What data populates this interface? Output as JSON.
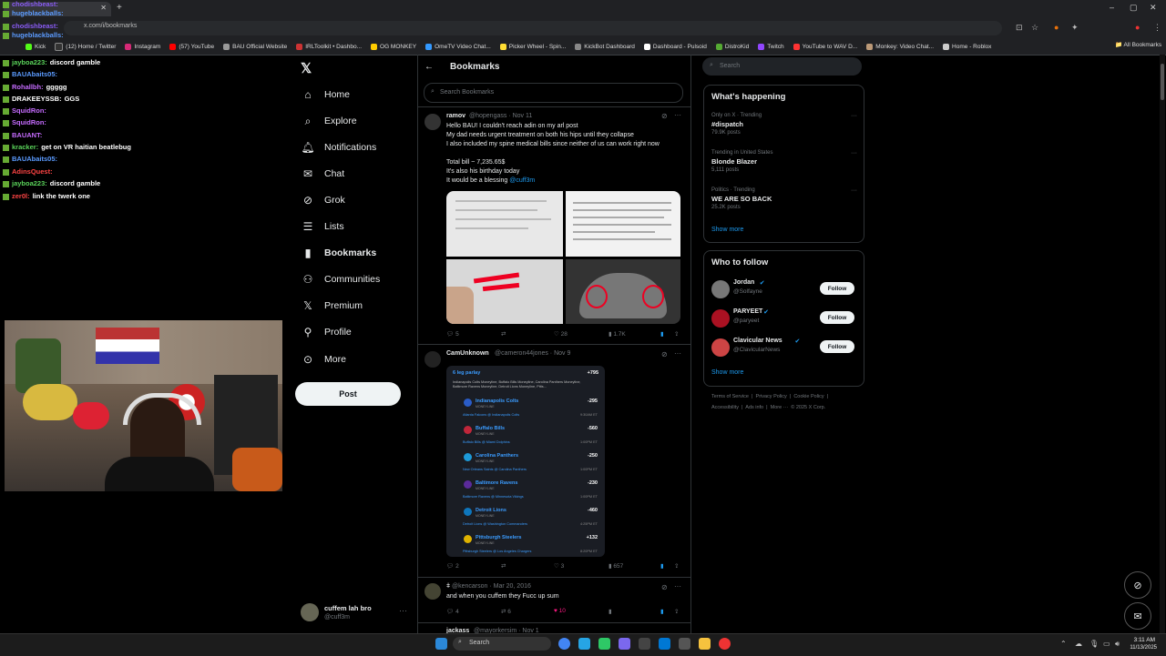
{
  "browser": {
    "url": "x.com/i/bookmarks",
    "bookmarks": [
      "Kick",
      "(12) Home / Twitter",
      "Instagram",
      "(57) YouTube",
      "BAU Official Website",
      "IRLToolkit • Dashbo...",
      "OG MONKEY",
      "OmeTV Video Chat...",
      "Picker Wheel - Spin...",
      "KickBot Dashboard",
      "Dashboard - Pulsoid",
      "DistroKid",
      "Twitch",
      "YouTube to WAV D...",
      "Monkey: Video Chat...",
      "Home - Roblox"
    ],
    "all_bookmarks": "All Bookmarks"
  },
  "chat": [
    {
      "user": "chodishbeast:",
      "msg": "",
      "color": "#8a5cf6"
    },
    {
      "user": "hugeblackballs:",
      "msg": "",
      "color": "#5b9bff"
    },
    {
      "user": "chodishbeast:",
      "msg": "",
      "color": "#8a5cf6"
    },
    {
      "user": "hugeblackballs:",
      "msg": "",
      "color": "#5b9bff"
    },
    {
      "user": "jayboa223:",
      "msg": "discord gamble",
      "color": "#5ad35a"
    },
    {
      "user": "BAUAbaits05:",
      "msg": "",
      "color": "#5b9bff"
    },
    {
      "user": "Rohallbh:",
      "msg": "ggggg",
      "color": "#c66cff"
    },
    {
      "user": "DRAKEEYSSB:",
      "msg": "GGS",
      "color": "#ffffff"
    },
    {
      "user": "SquidRon:",
      "msg": "",
      "color": "#c66cff"
    },
    {
      "user": "SquidRon:",
      "msg": "",
      "color": "#c66cff"
    },
    {
      "user": "BAUANT:",
      "msg": "",
      "color": "#c66cff"
    },
    {
      "user": "kracker:",
      "msg": "get on VR haitian beatlebug",
      "color": "#5ad35a"
    },
    {
      "user": "BAUAbaits05:",
      "msg": "",
      "color": "#5b9bff"
    },
    {
      "user": "AdinsQuest:",
      "msg": "",
      "color": "#ff4444"
    },
    {
      "user": "jayboa223:",
      "msg": "discord gamble",
      "color": "#5ad35a"
    },
    {
      "user": "zer0l:",
      "msg": "link the twerk one",
      "color": "#ff4444"
    }
  ],
  "nav": {
    "items": [
      "Home",
      "Explore",
      "Notifications",
      "Chat",
      "Grok",
      "Lists",
      "Bookmarks",
      "Communities",
      "Premium",
      "Profile",
      "More"
    ],
    "post": "Post",
    "account_name": "cuffem lah bro",
    "account_handle": "@cuff3m"
  },
  "center": {
    "title": "Bookmarks",
    "search_placeholder": "Search Bookmarks",
    "tweets": [
      {
        "name": "ramov",
        "handle": "@hopengass · Nov 11",
        "lines": [
          "Hello BAU! I couldn't reach adin on my arl post",
          "My dad needs urgent treatment on both his hips until they collapse",
          "I also included my spine medical bills since neither of us can work right now",
          "",
          "Total bill ~ 7,235.65$",
          "It's also his birthday today",
          "It would be a blessing"
        ],
        "mention": "@cuff3m",
        "replies": "5",
        "retweets": "",
        "likes": "28",
        "views": "1.7K"
      },
      {
        "name": "CamUnknown",
        "handle": "@cameron44jones · Nov 9",
        "replies": "2",
        "retweets": "",
        "likes": "3",
        "views": "657"
      },
      {
        "name": "",
        "handle": "@kencarson · Mar 20, 2016",
        "text": "and when you cuffem they Fucc up sum",
        "replies": "4",
        "retweets": "6",
        "likes": "10",
        "views": ""
      },
      {
        "name": "jackass",
        "handle": "@mayorkersim · Nov 1"
      }
    ],
    "parlay": {
      "title": "6 leg parlay",
      "odds": "+795",
      "summary": "Indianapolis Colts Moneyline, Buffalo Bills Moneyline, Carolina Panthers Moneyline, Baltimore Ravens Moneyline, Detroit Lions Moneyline, Pitts...",
      "picks": [
        {
          "team": "Indianapolis Colts",
          "odds": "-295",
          "game": "Atlanta Falcons @ Indianapolis Colts",
          "time": "9:30AM ET",
          "color": "#2a5cc7"
        },
        {
          "team": "Buffalo Bills",
          "odds": "-560",
          "game": "Buffalo Bills @ Miami Dolphins",
          "time": "1:00PM ET",
          "color": "#c0263a"
        },
        {
          "team": "Carolina Panthers",
          "odds": "-250",
          "game": "New Orleans Saints @ Carolina Panthers",
          "time": "1:00PM ET",
          "color": "#1d9ad8"
        },
        {
          "team": "Baltimore Ravens",
          "odds": "-230",
          "game": "Baltimore Ravens @ Minnesota Vikings",
          "time": "1:00PM ET",
          "color": "#5b2a9a"
        },
        {
          "team": "Detroit Lions",
          "odds": "-460",
          "game": "Detroit Lions @ Washington Commanders",
          "time": "4:25PM ET",
          "color": "#0e76bc"
        },
        {
          "team": "Pittsburgh Steelers",
          "odds": "+132",
          "game": "Pittsburgh Steelers @ Los Angeles Chargers",
          "time": "8:20PM ET",
          "color": "#e0b300"
        }
      ],
      "moneyline": "MONEYLINE"
    }
  },
  "right": {
    "search_placeholder": "Search",
    "whats_happening": "What's happening",
    "trends": [
      {
        "context": "Only on X · Trending",
        "name": "#dispatch",
        "posts": "79.9K posts"
      },
      {
        "context": "Trending in United States",
        "name": "Blonde Blazer",
        "posts": "5,111 posts"
      },
      {
        "context": "Politics · Trending",
        "name": "WE ARE SO BACK",
        "posts": "25.2K posts"
      }
    ],
    "show_more": "Show more",
    "who_to_follow": "Who to follow",
    "follow_list": [
      {
        "name": "Jordan",
        "handle": "@Solfayne",
        "color": "#777"
      },
      {
        "name": "PARYEET",
        "handle": "@paryeet",
        "color": "#a12"
      },
      {
        "name": "Clavicular News",
        "handle": "@ClavicularNews",
        "color": "#c44"
      }
    ],
    "follow_label": "Follow",
    "show_more_2": "Show more",
    "footer_1": [
      "Terms of Service",
      "|",
      "Privacy Policy",
      "|",
      "Cookie Policy",
      "|"
    ],
    "footer_2": [
      "Accessibility",
      "|",
      "Ads info",
      "|",
      "More ···",
      "© 2025 X Corp."
    ]
  },
  "taskbar": {
    "search": "Search",
    "time": "3:11 AM",
    "date": "11/13/2025"
  }
}
